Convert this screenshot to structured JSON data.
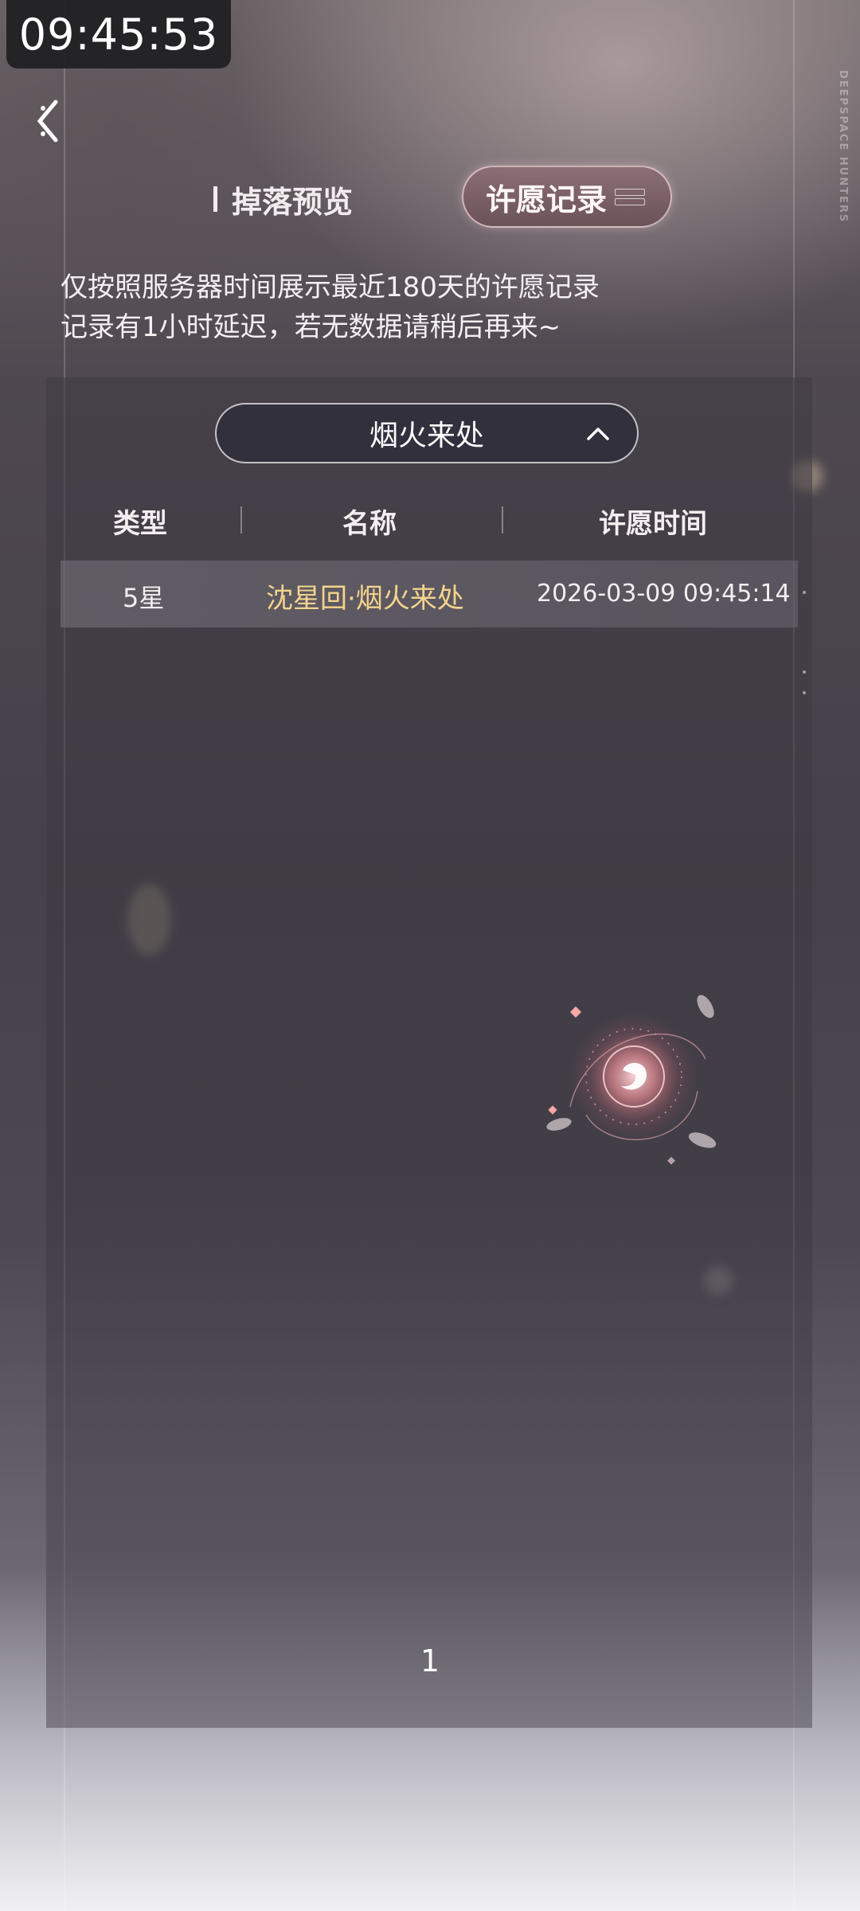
{
  "status": {
    "time": "09:45:53"
  },
  "brand_vertical": "DEEPSPACE HUNTERS",
  "tabs": {
    "drop_preview": "掉落预览",
    "wish_record": "许愿记录"
  },
  "notice": {
    "line1": "仅按照服务器时间展示最近180天的许愿记录",
    "line2": "记录有1小时延迟，若无数据请稍后再来~"
  },
  "filter": {
    "selected": "烟火来处"
  },
  "table": {
    "headers": [
      "类型",
      "名称",
      "许愿时间"
    ],
    "rows": [
      {
        "type": "5星",
        "name": "沈星回·烟火来处",
        "time": "2026-03-09 09:45:14"
      }
    ]
  },
  "pagination": {
    "page": "1"
  },
  "colors": {
    "highlight_name": "#f4d48c"
  },
  "icons": [
    "back-icon",
    "chevron-up-icon",
    "loading-spinner-icon"
  ]
}
